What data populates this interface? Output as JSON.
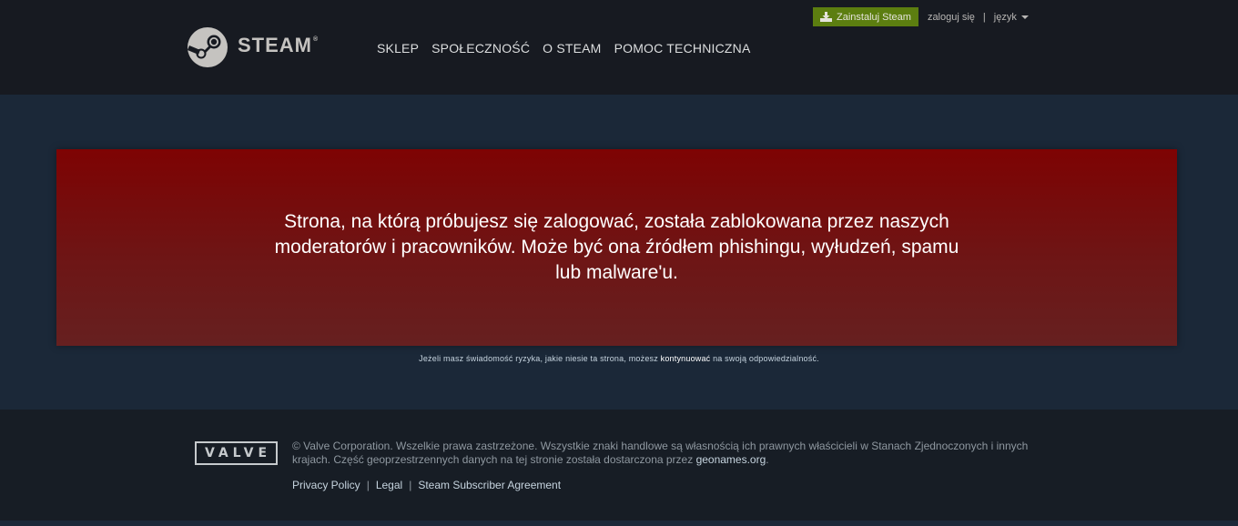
{
  "header": {
    "logo_text": "STEAM",
    "logo_trademark": "®",
    "nav": [
      {
        "label": "SKLEP"
      },
      {
        "label": "SPOŁECZNOŚĆ"
      },
      {
        "label": "O STEAM"
      },
      {
        "label": "POMOC TECHNICZNA"
      }
    ],
    "install_label": "Zainstaluj Steam",
    "login_label": "zaloguj się",
    "separator": "|",
    "language_label": "język"
  },
  "warning": {
    "message": "Strona, na którą próbujesz się zalogować, została zablokowana przez naszych moderatorów i pracowników. Może być ona źródłem phishingu, wyłudzeń, spamu lub malware'u."
  },
  "continue_note": {
    "before": "Jeżeli masz świadomość ryzyka, jakie niesie ta strona, możesz ",
    "link": "kontynuować",
    "after": " na swoją odpowiedzialność."
  },
  "footer": {
    "valve_logo": "VALVE",
    "legal_text": "© Valve Corporation. Wszelkie prawa zastrzeżone. Wszystkie znaki handlowe są własnością ich prawnych właścicieli w Stanach Zjednoczonych i innych krajach. Część geoprzestrzennych danych na tej stronie została dostarczona przez ",
    "geonames_link": "geonames.org",
    "legal_end": ".",
    "links": [
      {
        "label": "Privacy Policy"
      },
      {
        "label": "Legal"
      },
      {
        "label": "Steam Subscriber Agreement"
      }
    ],
    "link_separator": "|"
  },
  "colors": {
    "header_bg": "#171a21",
    "page_bg": "#1b2838",
    "footer_bg": "#171d25",
    "install_button": "#5c7e10",
    "warning_top": "#7e0303",
    "warning_bottom": "#662020"
  }
}
